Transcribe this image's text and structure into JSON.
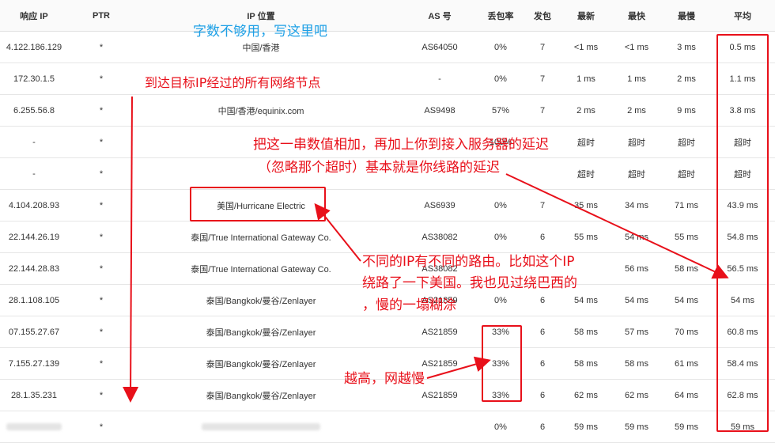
{
  "headers": [
    "响应 IP",
    "PTR",
    "IP 位置",
    "AS 号",
    "丢包率",
    "发包",
    "最新",
    "最快",
    "最慢",
    "平均"
  ],
  "rows": [
    {
      "ip": "4.122.186.129",
      "ptr": "*",
      "loc": "中国/香港",
      "as": "AS64050",
      "loss": "0%",
      "sent": "7",
      "last": "<1 ms",
      "best": "<1 ms",
      "worst": "3 ms",
      "avg": "0.5 ms"
    },
    {
      "ip": "172.30.1.5",
      "ptr": "*",
      "loc": "",
      "as": "-",
      "loss": "0%",
      "sent": "7",
      "last": "1 ms",
      "best": "1 ms",
      "worst": "2 ms",
      "avg": "1.1 ms"
    },
    {
      "ip": "6.255.56.8",
      "ptr": "*",
      "loc": "中国/香港/equinix.com",
      "as": "AS9498",
      "loss": "57%",
      "sent": "7",
      "last": "2 ms",
      "best": "2 ms",
      "worst": "9 ms",
      "avg": "3.8 ms"
    },
    {
      "ip": "-",
      "ptr": "*",
      "loc": "",
      "as": "",
      "loss": "100%",
      "sent": "",
      "last": "超时",
      "best": "超时",
      "worst": "超时",
      "avg": "超时"
    },
    {
      "ip": "-",
      "ptr": "*",
      "loc": "",
      "as": "",
      "loss": "",
      "sent": "",
      "last": "超时",
      "best": "超时",
      "worst": "超时",
      "avg": "超时"
    },
    {
      "ip": "4.104.208.93",
      "ptr": "*",
      "loc": "美国/Hurricane Electric",
      "as": "AS6939",
      "loss": "0%",
      "sent": "7",
      "last": "35 ms",
      "best": "34 ms",
      "worst": "71 ms",
      "avg": "43.9 ms"
    },
    {
      "ip": "22.144.26.19",
      "ptr": "*",
      "loc": "泰国/True International Gateway Co.",
      "as": "AS38082",
      "loss": "0%",
      "sent": "6",
      "last": "55 ms",
      "best": "54 ms",
      "worst": "55 ms",
      "avg": "54.8 ms"
    },
    {
      "ip": "22.144.28.83",
      "ptr": "*",
      "loc": "泰国/True International Gateway Co.",
      "as": "AS38082",
      "loss": "",
      "sent": "",
      "last": "",
      "best": "56 ms",
      "worst": "58 ms",
      "avg": "56.5 ms"
    },
    {
      "ip": "28.1.108.105",
      "ptr": "*",
      "loc": "泰国/Bangkok/曼谷/Zenlayer",
      "as": "AS21859",
      "loss": "0%",
      "sent": "6",
      "last": "54 ms",
      "best": "54 ms",
      "worst": "54 ms",
      "avg": "54 ms"
    },
    {
      "ip": "07.155.27.67",
      "ptr": "*",
      "loc": "泰国/Bangkok/曼谷/Zenlayer",
      "as": "AS21859",
      "loss": "33%",
      "sent": "6",
      "last": "58 ms",
      "best": "57 ms",
      "worst": "70 ms",
      "avg": "60.8 ms"
    },
    {
      "ip": "7.155.27.139",
      "ptr": "*",
      "loc": "泰国/Bangkok/曼谷/Zenlayer",
      "as": "AS21859",
      "loss": "33%",
      "sent": "6",
      "last": "58 ms",
      "best": "58 ms",
      "worst": "61 ms",
      "avg": "58.4 ms"
    },
    {
      "ip": "28.1.35.231",
      "ptr": "*",
      "loc": "泰国/Bangkok/曼谷/Zenlayer",
      "as": "AS21859",
      "loss": "33%",
      "sent": "6",
      "last": "62 ms",
      "best": "62 ms",
      "worst": "64 ms",
      "avg": "62.8 ms"
    },
    {
      "ip": "",
      "ptr": "*",
      "loc": "",
      "as": "",
      "loss": "0%",
      "sent": "6",
      "last": "59 ms",
      "best": "59 ms",
      "worst": "59 ms",
      "avg": "59 ms"
    }
  ],
  "annotations": {
    "top_note": "字数不够用，写这里吧",
    "path_note": "到达目标IP经过的所有网络节点",
    "sum_note_1": "把这一串数值相加，再加上你到接入服务器的延迟",
    "sum_note_2": "（忽略那个超时）基本就是你线路的延迟",
    "route_note_1": "不同的IP有不同的路由。比如这个IP",
    "route_note_2": "绕路了一下美国。我也见过绕巴西的",
    "route_note_3": "，慢的一塌糊涂",
    "loss_note": "越高，网越慢"
  }
}
